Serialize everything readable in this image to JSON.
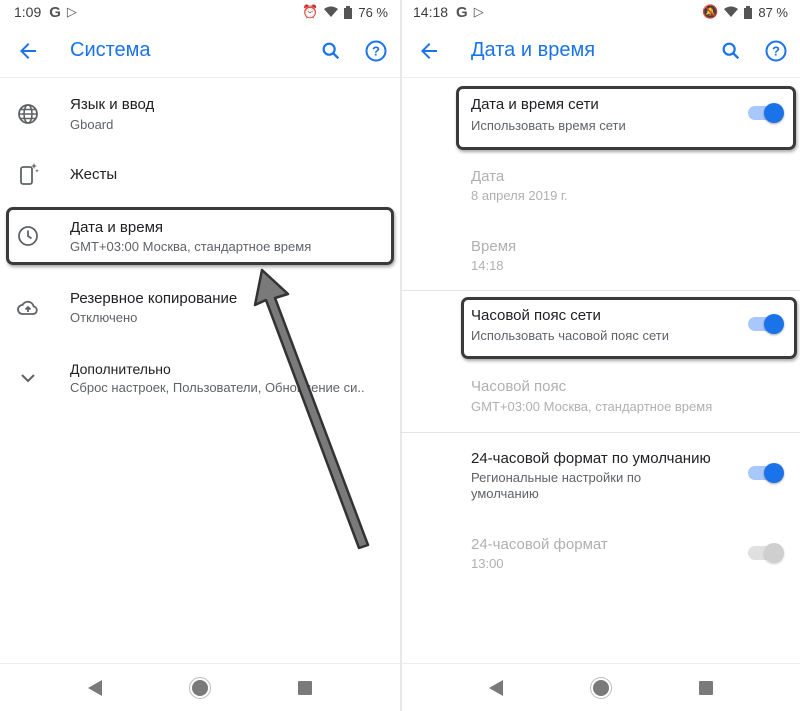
{
  "left": {
    "status": {
      "time": "1:09",
      "battery": "76 %"
    },
    "appbar": {
      "title": "Система"
    },
    "items": [
      {
        "title": "Язык и ввод",
        "subtitle": "Gboard"
      },
      {
        "title": "Жесты",
        "subtitle": ""
      },
      {
        "title": "Дата и время",
        "subtitle": "GMT+03:00 Москва, стандартное время"
      },
      {
        "title": "Резервное копирование",
        "subtitle": "Отключено"
      },
      {
        "title": "Дополнительно",
        "subtitle": "Сброс настроек, Пользователи, Обновление си.."
      }
    ]
  },
  "right": {
    "status": {
      "time": "14:18",
      "battery": "87 %"
    },
    "appbar": {
      "title": "Дата и время"
    },
    "items": [
      {
        "title": "Дата и время сети",
        "subtitle": "Использовать время сети",
        "toggle": "on"
      },
      {
        "title": "Дата",
        "subtitle": "8 апреля 2019 г."
      },
      {
        "title": "Время",
        "subtitle": "14:18"
      },
      {
        "title": "Часовой пояс сети",
        "subtitle": "Использовать часовой пояс сети",
        "toggle": "on"
      },
      {
        "title": "Часовой пояс",
        "subtitle": "GMT+03:00 Москва, стандартное время"
      },
      {
        "title": "24-часовой формат по умолчанию",
        "subtitle_line1": "Региональные настройки по",
        "subtitle_line2": "умолчанию",
        "toggle": "on"
      },
      {
        "title": "24-часовой формат",
        "subtitle": "13:00",
        "toggle": "off-disabled"
      }
    ]
  },
  "colors": {
    "accent": "#1a73e8",
    "toggle_track": "#a8c7fa",
    "highlight_border": "#3a3a3a"
  },
  "icons": [
    "back-arrow-icon",
    "search-icon",
    "help-icon",
    "globe-icon",
    "gestures-icon",
    "clock-icon",
    "backup-icon",
    "chevron-down-icon"
  ]
}
